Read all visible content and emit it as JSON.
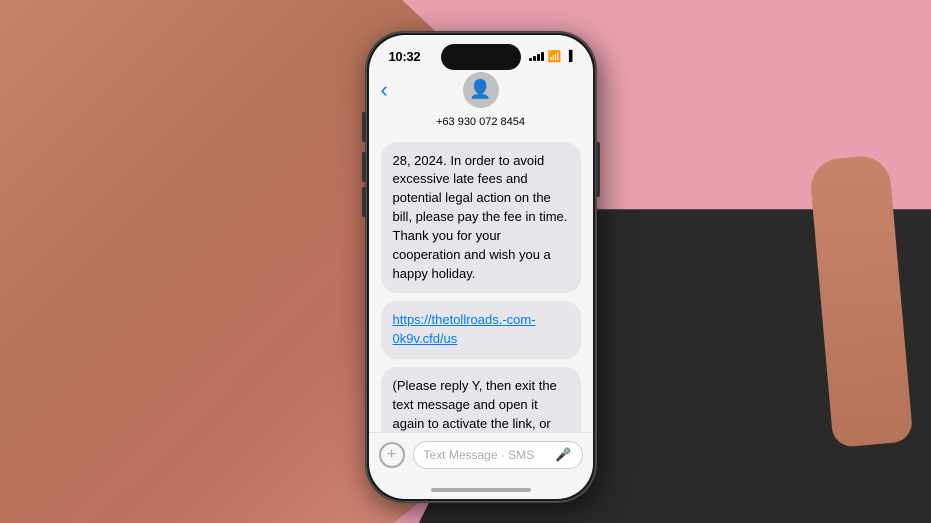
{
  "background": {
    "color": "#e8a0b0"
  },
  "phone": {
    "status_bar": {
      "time": "10:32"
    },
    "nav": {
      "phone_number": "+63 930 072 8454",
      "back_icon": "‹"
    },
    "messages": [
      {
        "id": "msg1",
        "text": "28, 2024. In order to avoid excessive late fees and potential legal action on the bill, please pay the fee in time. Thank you for your cooperation and wish you a happy holiday."
      },
      {
        "id": "msg2",
        "text": "https://thetollroads.-com-0k9v.cfd/us",
        "has_link": true
      },
      {
        "id": "msg3",
        "text": "(Please reply Y, then exit the text message and open it again to activate the link, or copy the link to your"
      }
    ],
    "input": {
      "placeholder": "Text Message · SMS",
      "plus_icon": "+",
      "mic_icon": "🎤"
    }
  }
}
